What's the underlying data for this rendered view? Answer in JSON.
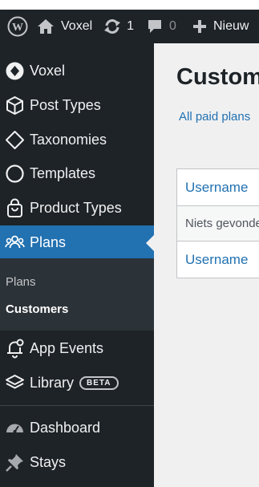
{
  "admin_bar": {
    "site_name": "Voxel",
    "updates_count": "1",
    "comments_count": "0",
    "new_label": "Nieuw"
  },
  "sidebar": {
    "items": [
      {
        "label": "Voxel",
        "icon": "voxel-icon"
      },
      {
        "label": "Post Types",
        "icon": "cube-icon"
      },
      {
        "label": "Taxonomies",
        "icon": "diamond-icon"
      },
      {
        "label": "Templates",
        "icon": "circle-icon"
      },
      {
        "label": "Product Types",
        "icon": "bag-icon"
      },
      {
        "label": "Plans",
        "icon": "users-icon",
        "current": true
      },
      {
        "label": "App Events",
        "icon": "bell-icon"
      },
      {
        "label": "Library",
        "icon": "layers-icon",
        "badge": "BETA"
      },
      {
        "label": "Dashboard",
        "icon": "dashboard-icon"
      },
      {
        "label": "Stays",
        "icon": "pin-icon"
      }
    ],
    "submenu": [
      {
        "label": "Plans"
      },
      {
        "label": "Customers",
        "current": true
      }
    ]
  },
  "main": {
    "title": "Customers",
    "filter_link": "All paid plans",
    "table": {
      "header": "Username",
      "empty_message": "Niets gevonden",
      "footer": "Username"
    }
  },
  "colors": {
    "admin_bg": "#1d2327",
    "accent": "#2271b1",
    "submenu_bg": "#2c3338",
    "content_bg": "#f0f0f1"
  }
}
